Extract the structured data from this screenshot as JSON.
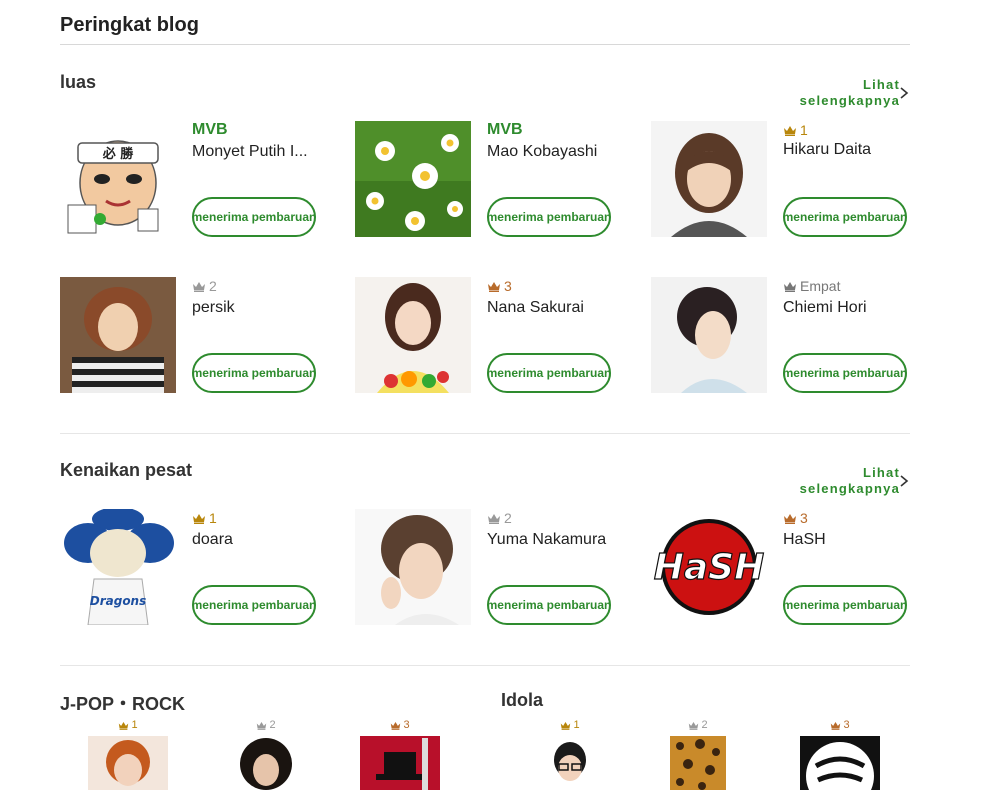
{
  "page": {
    "title": "Peringkat blog"
  },
  "colors": {
    "accent": "#2e8b2e",
    "gold": "#b8860b",
    "silver": "#999999",
    "bronze": "#b86b2b"
  },
  "follow_label": "menerima pembaruan",
  "sections": [
    {
      "title": "luas",
      "more_label_1": "Lihat",
      "more_label_2": "selengkapnya",
      "items": [
        {
          "rank": "MVB",
          "name": "Monyet Putih I...",
          "image": "mascot-headband"
        },
        {
          "rank": "MVB",
          "name": "Mao Kobayashi",
          "image": "daisy-flowers"
        },
        {
          "rank": "1",
          "name": "Hikaru Daita",
          "image": "woman-portrait"
        },
        {
          "rank": "2",
          "name": "persik",
          "image": "woman-striped"
        },
        {
          "rank": "3",
          "name": "Nana Sakurai",
          "image": "woman-vegetables"
        },
        {
          "rank": "Empat",
          "name": "Chiemi Hori",
          "image": "woman-profile"
        }
      ]
    },
    {
      "title": "Kenaikan pesat",
      "more_label_1": "Lihat",
      "more_label_2": "selengkapnya",
      "items": [
        {
          "rank": "1",
          "name": "doara",
          "image": "dragons-mascot"
        },
        {
          "rank": "2",
          "name": "Yuma Nakamura",
          "image": "man-portrait"
        },
        {
          "rank": "3",
          "name": "HaSH",
          "image": "hash-logo"
        }
      ]
    }
  ],
  "bottom": [
    {
      "title": "J-POP・ROCK",
      "ranks": [
        "1",
        "2",
        "3"
      ]
    },
    {
      "title": "Idola",
      "ranks": [
        "1",
        "2",
        "3"
      ]
    }
  ],
  "logo_text": {
    "hash": "HaSH"
  }
}
